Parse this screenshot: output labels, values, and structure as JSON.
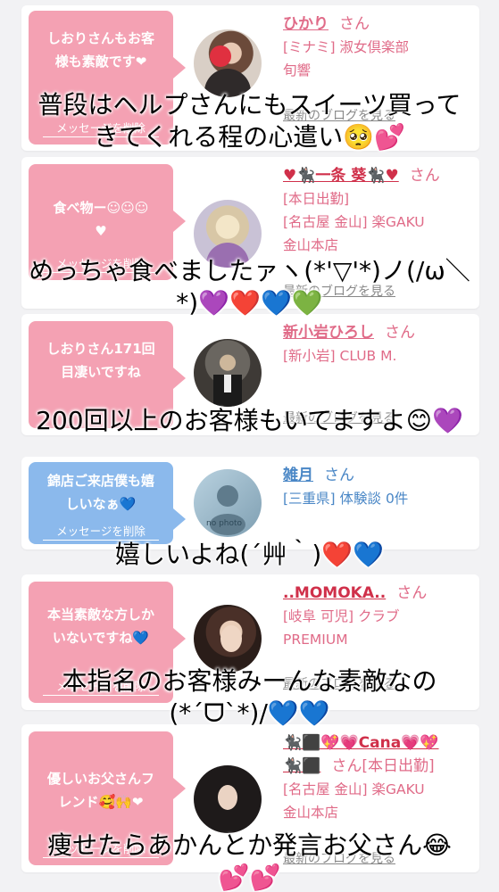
{
  "cards": [
    {
      "message": "しおりさんもお客\n様も素敵です❤",
      "delete_label": "メッセージを削除",
      "name": "ひかり",
      "san": "さん",
      "detail": "[ミナミ] 淑女倶楽部\n旬響",
      "blog_label": "最新のブログを見る",
      "avatar": "photo-avatar"
    },
    {
      "message": "食べ物ー☺☺☺\n♥",
      "delete_label": "メッセージを削除",
      "name": "♥🐈‍⬛一条 葵🐈‍⬛♥",
      "san": "さん",
      "detail": "[本日出勤]\n[名古屋 金山] 楽GAKU\n金山本店",
      "blog_label": "最新のブログを見る",
      "avatar": "photo-avatar"
    },
    {
      "message": "しおりさん171回\n目凄いですね",
      "delete_label": "",
      "name": "新小岩ひろし",
      "san": "さん",
      "detail": "[新小岩] CLUB M.",
      "blog_label": "最新のブログを見る",
      "avatar": "photo-avatar"
    },
    {
      "message": "錦店ご来店僕も嬉\nしいなぁ💙",
      "delete_label": "メッセージを削除",
      "name": "雑月",
      "san": "さん",
      "detail": "[三重県] 体験談 0件",
      "blog_label": "",
      "avatar": "no-photo-avatar",
      "no_photo_label": "no photo"
    },
    {
      "message": "本当素敵な方しか\nいないですね💙",
      "delete_label": "メッセージを削除",
      "name": "..MOMOKA..",
      "san": "さん",
      "detail": "[岐阜 可児] クラブ\nPREMIUM",
      "blog_label": "最新のブログを見る",
      "avatar": "photo-avatar"
    },
    {
      "message": "優しいお父さんフ\nレンド🥰🙌❤",
      "delete_label": "メッセージを削除",
      "name": "🐈‍⬛⬛💖💗Cana💗💖",
      "name2": "🐈‍⬛⬛",
      "san": "さん[本日出勤]",
      "detail": "[名古屋 金山] 楽GAKU\n金山本店",
      "blog_label": "最新のブログを見る",
      "avatar": "photo-avatar"
    }
  ],
  "captions": [
    "普段はヘルプさんにもスイーツ買って\nきてくれる程の心遣い🥺💕",
    "めっちゃ食べましたァヽ(*'▽'*)ノ(/ω＼\n*)💜❤️💙💚",
    "200回以上のお客様もいてますよ😊💜",
    "嬉しいよね(´艸｀)❤️💙",
    "本指名のお客様みーんな素敵なの\n(*´ᗜ`*)/💙💙",
    "痩せたらあかんとか発言お父さん😂\n💕💕"
  ],
  "colors": {
    "pink_bubble": "#f4a1b3",
    "blue_bubble": "#8bb9ec",
    "pink_text": "#e06b88",
    "blue_text": "#4a87c6"
  }
}
